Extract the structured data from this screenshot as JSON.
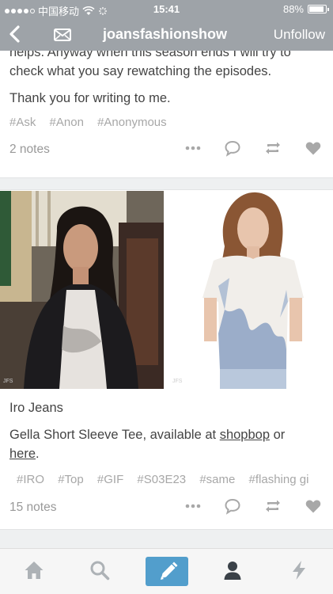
{
  "status_bar": {
    "carrier": "中国移动",
    "time": "15:41",
    "battery": "88%",
    "battery_level": 0.88
  },
  "nav": {
    "blog_name": "joansfashionshow",
    "unfollow_label": "Unfollow"
  },
  "post1": {
    "cut_line": "helps. Anyway when this season ends I will try to",
    "text_line": "check what you say rewatching the episodes.",
    "thanks": "Thank you for writing to me.",
    "tags": [
      "#Ask",
      "#Anon",
      "#Anonymous"
    ],
    "notes": "2 notes"
  },
  "post2": {
    "watermark_left": "JFS",
    "watermark_right": "JFS",
    "brand": "Iro Jeans",
    "desc_prefix": "Gella Short Sleeve Tee, available at ",
    "link1": "shopbop",
    "desc_mid": " or",
    "link2": "here",
    "desc_suffix": ".",
    "tags": [
      "#IRO",
      "#Top",
      "#GIF",
      "#S03E23",
      "#same",
      "#flashing gi"
    ],
    "notes": "15 notes"
  },
  "tabs": [
    "home-icon",
    "search-icon",
    "compose-icon",
    "account-icon",
    "activity-icon"
  ],
  "colors": {
    "header": "#9ea3a8",
    "accent": "#529ecc",
    "muted": "#a7a7a7"
  }
}
